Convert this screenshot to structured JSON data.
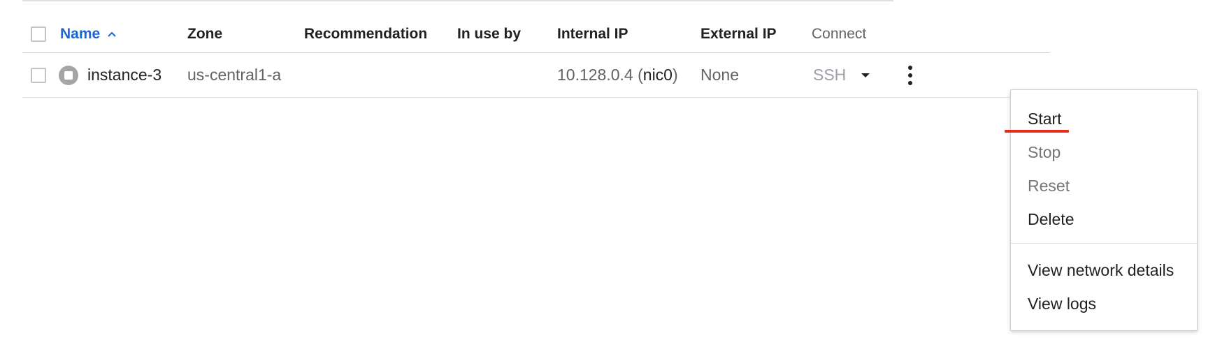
{
  "table": {
    "headers": {
      "name": "Name",
      "zone": "Zone",
      "recommendation": "Recommendation",
      "in_use_by": "In use by",
      "internal_ip": "Internal IP",
      "external_ip": "External IP",
      "connect": "Connect"
    },
    "rows": [
      {
        "name": "instance-3",
        "zone": "us-central1-a",
        "recommendation": "",
        "in_use_by": "",
        "internal_ip": "10.128.0.4",
        "internal_ip_nic_open": " (",
        "internal_ip_nic": "nic0",
        "internal_ip_nic_close": ")",
        "external_ip": "None",
        "connect": "SSH",
        "status": "stopped"
      }
    ]
  },
  "menu": {
    "items": [
      {
        "label": "Start",
        "enabled": true
      },
      {
        "label": "Stop",
        "enabled": false
      },
      {
        "label": "Reset",
        "enabled": false
      },
      {
        "label": "Delete",
        "enabled": true
      },
      {
        "label": "View network details",
        "enabled": true
      },
      {
        "label": "View logs",
        "enabled": true
      }
    ]
  },
  "icons": {
    "sort": "chevron-up-icon",
    "status": "stopped-status-icon",
    "connect_dropdown": "caret-down-icon",
    "row_menu": "more-vert-icon"
  },
  "colors": {
    "accent": "#1a67d2",
    "annotation": "#e8291c",
    "status_stopped": "#a5a5a5",
    "disabled_text": "#9aa0a6"
  }
}
